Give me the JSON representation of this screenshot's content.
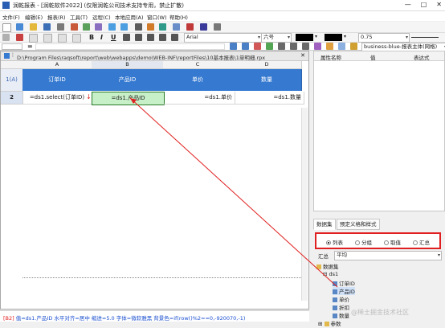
{
  "window": {
    "title": "润乾报表 - [润乾软件2022] (仅限润乾公司技术支持专用，禁止扩散)",
    "controls": [
      "—",
      "□",
      "✕"
    ]
  },
  "menu": [
    "文件(F)",
    "编辑(E)",
    "报表(R)",
    "工具(T)",
    "远程(C)",
    "本地应用(A)",
    "窗口(W)",
    "帮助(H)"
  ],
  "toolbar": {
    "font_name": "Arial",
    "font_size": "六号",
    "line_width": "0.75",
    "bold": "B",
    "italic": "I",
    "underline": "U",
    "style_select": "business-blue-报表主体(网格)"
  },
  "formula_bar": {
    "cell_ref": "",
    "equals": "=",
    "value": ""
  },
  "document": {
    "path": "D:\\Program Files\\raqsoft\\report\\web\\webapps\\demo\\WEB-INF\\reportFiles\\10基本报表\\1单明细.rpx",
    "corner": "",
    "columns": [
      "A",
      "B",
      "C",
      "D"
    ],
    "rows": [
      {
        "label": "1(A)",
        "cells": [
          "订单ID",
          "产品ID",
          "单价",
          "数量"
        ]
      },
      {
        "label": "2",
        "cells": [
          "=ds1.select(订单ID)",
          "=ds1.产品ID",
          "=ds1.单价",
          "=ds1.数量"
        ]
      }
    ]
  },
  "properties": {
    "headers": [
      "属性名称",
      "值",
      "表达式"
    ]
  },
  "dataset_tabs": [
    "数据集",
    "预定义格和样式"
  ],
  "radios": [
    {
      "label": "列表",
      "selected": true
    },
    {
      "label": "分组",
      "selected": false
    },
    {
      "label": "取值",
      "selected": false
    },
    {
      "label": "汇总",
      "selected": false
    }
  ],
  "aggregate": {
    "label": "汇总",
    "value": "平均"
  },
  "tree": {
    "root": "数据集",
    "dataset": "ds1",
    "fields": [
      "订单ID",
      "产品ID",
      "单价",
      "折扣",
      "数量"
    ],
    "params": "参数"
  },
  "status": {
    "cell": "[B2]",
    "text": " 值=ds1.产品ID 水平对齐=居中 缩进=5.0 字体=微软雅黑 背景色=if(row()%2==0,-920070,-1)"
  },
  "watermark": "@稀土掘金技术社区",
  "colors": {
    "header_blue": "#3579d0",
    "selected_cell": "#c8f0c8",
    "annotation_red": "#e02020"
  }
}
